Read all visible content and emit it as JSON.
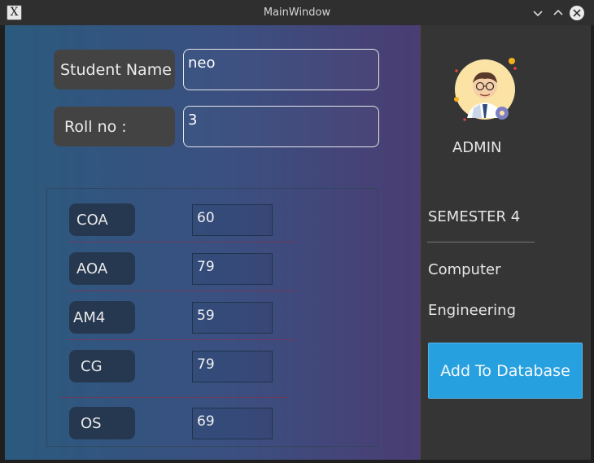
{
  "window": {
    "title": "MainWindow",
    "icons": [
      "app-x-icon",
      "minimize-icon",
      "maximize-icon",
      "close-icon"
    ]
  },
  "form": {
    "student_name_label": "Student Name",
    "student_name_value": "neo",
    "roll_label": "Roll no :",
    "roll_value": "3"
  },
  "marks": [
    {
      "subject": "COA",
      "score": "60"
    },
    {
      "subject": "AOA",
      "score": "79"
    },
    {
      "subject": "AM4",
      "score": "59"
    },
    {
      "subject": "CG",
      "score": "79"
    },
    {
      "subject": "OS",
      "score": "69"
    }
  ],
  "sidebar": {
    "role": "ADMIN",
    "semester": "SEMESTER 4",
    "branch_line1": "Computer",
    "branch_line2": "Engineering",
    "button_label": "Add To Database"
  },
  "colors": {
    "accent_button": "#27a0e0",
    "panel_gradient_start": "#2b5a7e",
    "panel_gradient_end": "#4a3d73",
    "sidebar_bg": "#353535"
  }
}
